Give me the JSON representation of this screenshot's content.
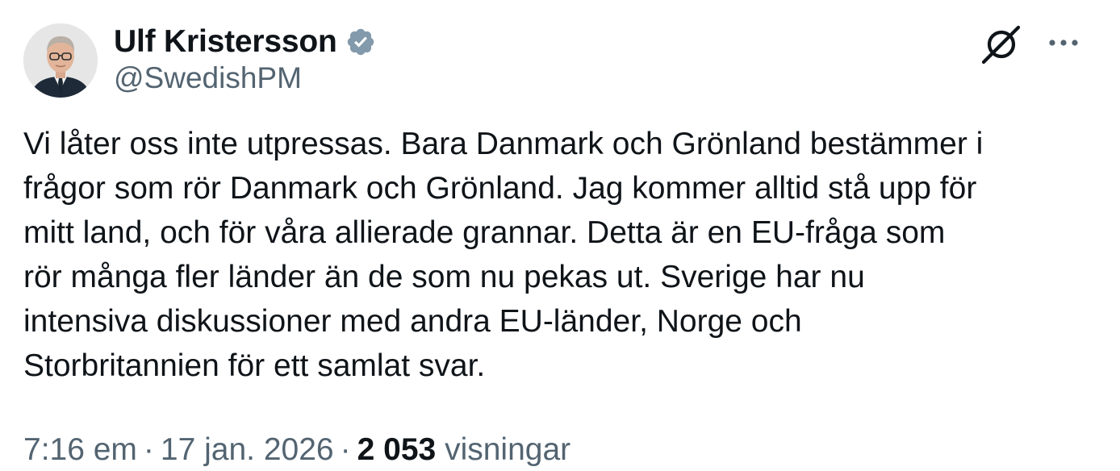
{
  "author": {
    "display_name": "Ulf Kristersson",
    "handle": "@SwedishPM",
    "verified_icon": "verified-badge-icon",
    "verified_color": "#829aab",
    "avatar_icon": "avatar-photo"
  },
  "tweet": {
    "text_lines": [
      "Vi låter oss inte utpressas. Bara Danmark och Grönland bestämmer i",
      "frågor som rör Danmark och Grönland. Jag kommer alltid stå upp för",
      "mitt land, och för våra allierade grannar. Detta är en EU-fråga som",
      "rör många fler länder än de som nu pekas ut. Sverige har nu",
      "intensiva diskussioner med andra EU-länder, Norge och",
      "Storbritannien för ett samlat svar."
    ]
  },
  "meta": {
    "time": "7:16 em",
    "separator": "·",
    "date": "17 jan. 2026",
    "views_count": "2 053",
    "views_label": "visningar"
  },
  "actions": {
    "grok_icon": "grok-icon",
    "more_icon": "more-options-icon"
  },
  "colors": {
    "text_primary": "#0f1419",
    "text_secondary": "#536471"
  }
}
